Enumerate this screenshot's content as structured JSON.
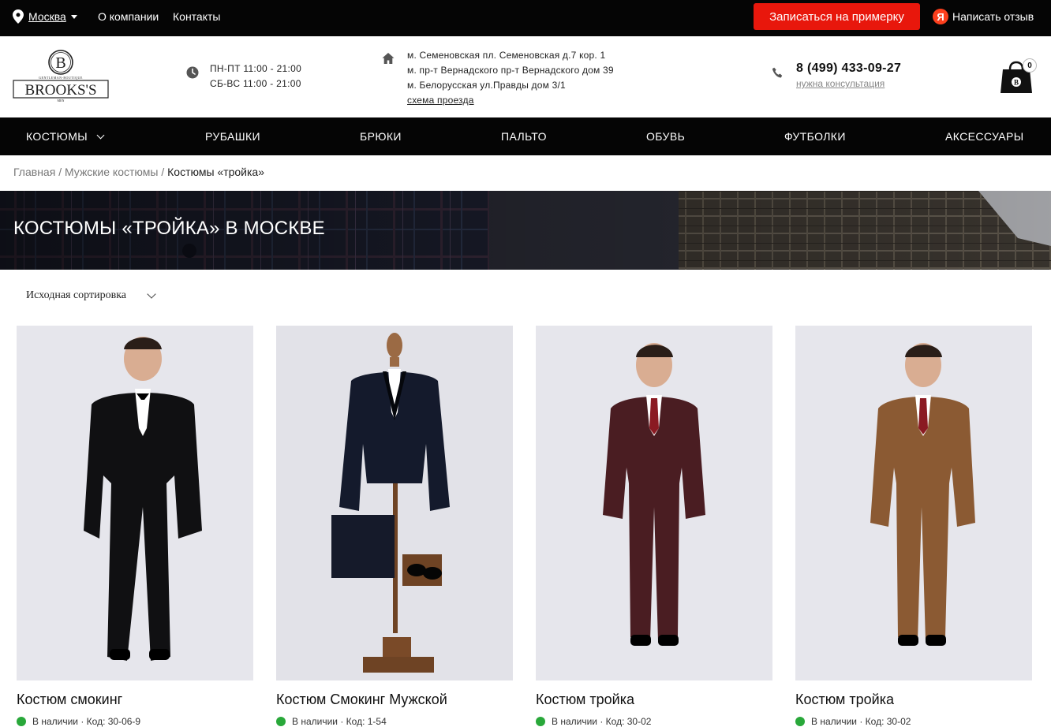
{
  "topbar": {
    "city": "Москва",
    "links": [
      "О компании",
      "Контакты"
    ],
    "cta_label": "Записаться на примерку",
    "review_icon_letter": "Я",
    "review_label": "Написать отзыв",
    "cta_color": "#e8170c"
  },
  "header": {
    "logo_letter": "B",
    "logo_text": "BROOKS'S",
    "logo_small_top": "GENTLEMAN-BOUTIQUE",
    "logo_small_bottom": "MEN",
    "hours": [
      "ПН-ПТ 11:00 - 21:00",
      "СБ-ВС 11:00 - 21:00"
    ],
    "addresses": [
      "м. Семеновская пл. Семеновская д.7 кор. 1",
      "м. пр-т Вернадского пр-т Вернадского дом 39",
      "м. Белорусская ул.Правды дом 3/1"
    ],
    "route_link": "схема проезда",
    "phone": "8 (499) 433-09-27",
    "consult_link": "нужна консультация",
    "cart_count": "0",
    "cart_letter": "B"
  },
  "nav": {
    "items": [
      "КОСТЮМЫ",
      "РУБАШКИ",
      "БРЮКИ",
      "ПАЛЬТО",
      "ОБУВЬ",
      "ФУТБОЛКИ",
      "АКСЕССУАРЫ"
    ]
  },
  "breadcrumb": {
    "home": "Главная",
    "sep": "/",
    "section": "Мужские костюмы",
    "current": "Костюмы «тройка»"
  },
  "banner": {
    "title": "КОСТЮМЫ «ТРОЙКА» В МОСКВЕ"
  },
  "sort": {
    "label": "Исходная сортировка"
  },
  "products": [
    {
      "name": "Костюм смокинг",
      "stock": "В наличии · Код: 30-06-9",
      "suit_color": "#101012"
    },
    {
      "name": "Костюм Смокинг Мужской",
      "stock": "В наличии · Код: 1-54",
      "suit_color": "#141a2c"
    },
    {
      "name": "Костюм тройка",
      "stock": "В наличии · Код: 30-02",
      "suit_color": "#4a1d22"
    },
    {
      "name": "Костюм тройка",
      "stock": "В наличии · Код: 30-02",
      "suit_color": "#8b5a33"
    }
  ]
}
